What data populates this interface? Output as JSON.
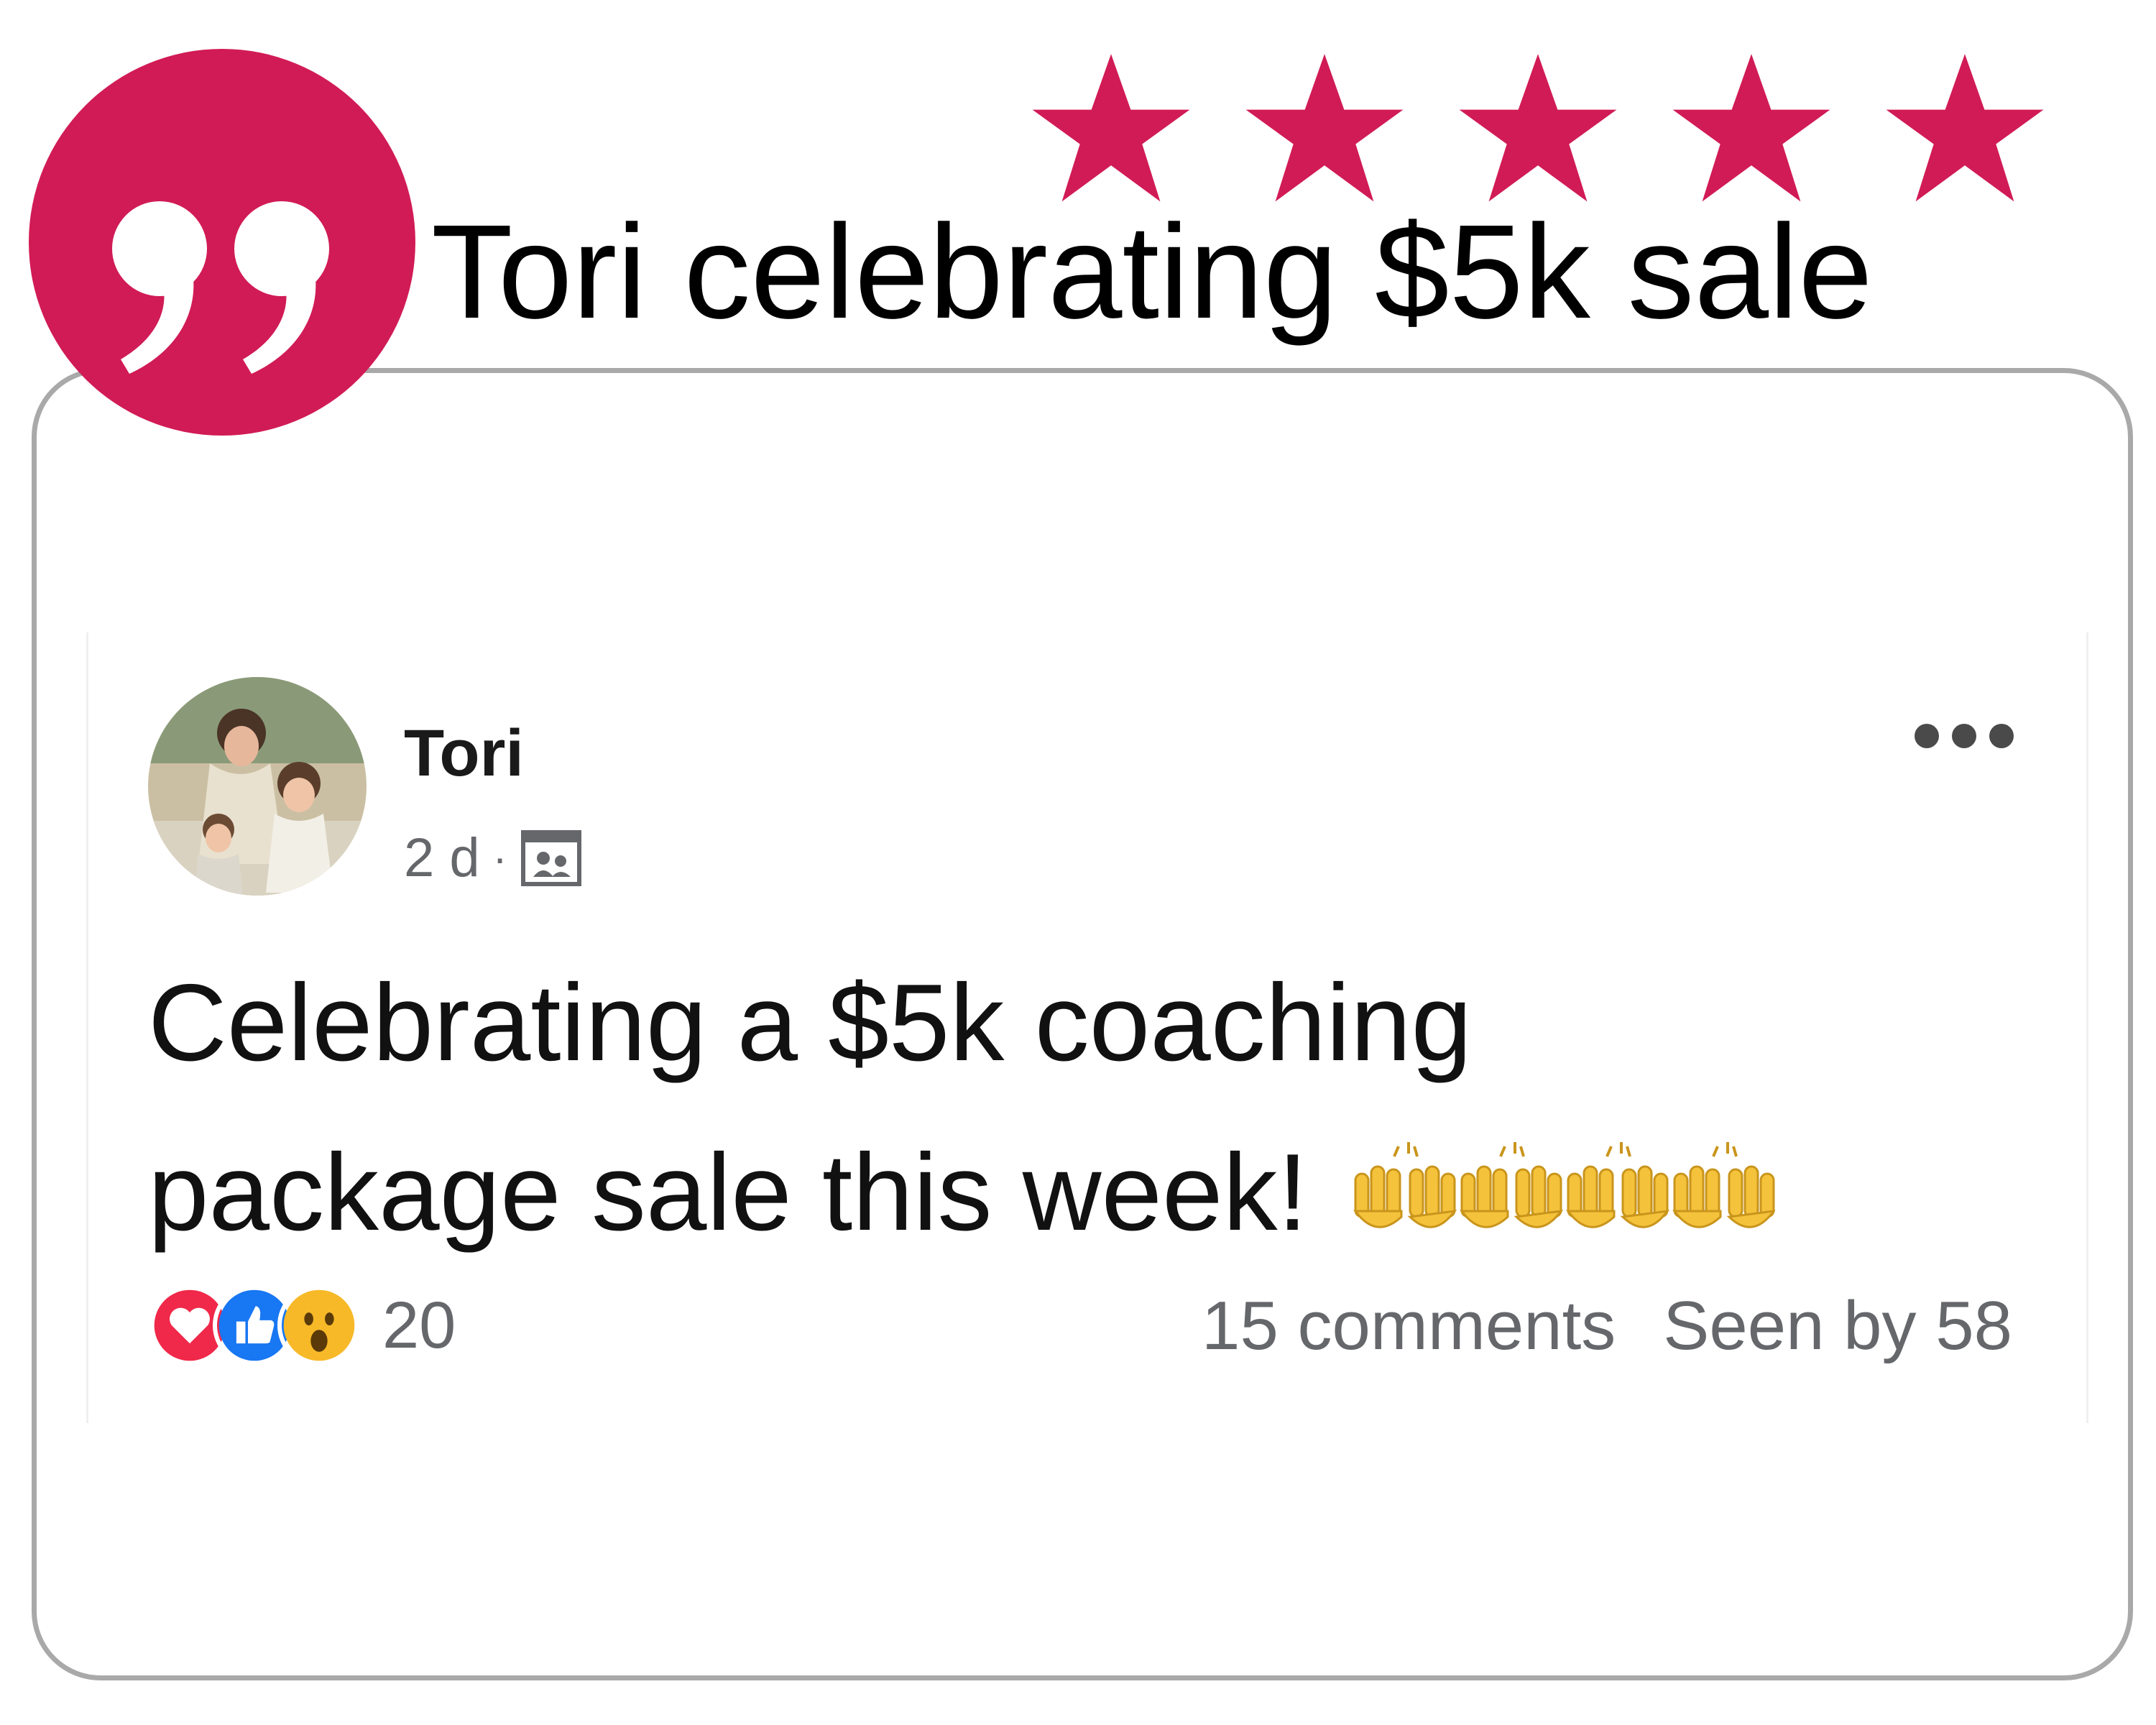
{
  "header": {
    "title": "Tori celebrating $5k sale",
    "stars_filled": 5,
    "stars_total": 5,
    "accent_color": "#d11b56",
    "quote_icon": "quote-icon",
    "star_icon": "star-icon"
  },
  "post": {
    "author_name": "Tori",
    "time": "2 d",
    "separator": "·",
    "audience_icon": "group-audience-icon",
    "more_icon": "more-options-icon",
    "text_line1": "Celebrating a $5k coaching",
    "text_line2": "package sale this week!",
    "emoji_icon": "raising-hands-emoji",
    "emoji_count": 4,
    "reaction_icons": [
      "love-reaction-icon",
      "like-reaction-icon",
      "wow-reaction-icon"
    ],
    "reactions_count": "20",
    "comments": "15 comments",
    "seen_by": "Seen by 58"
  }
}
